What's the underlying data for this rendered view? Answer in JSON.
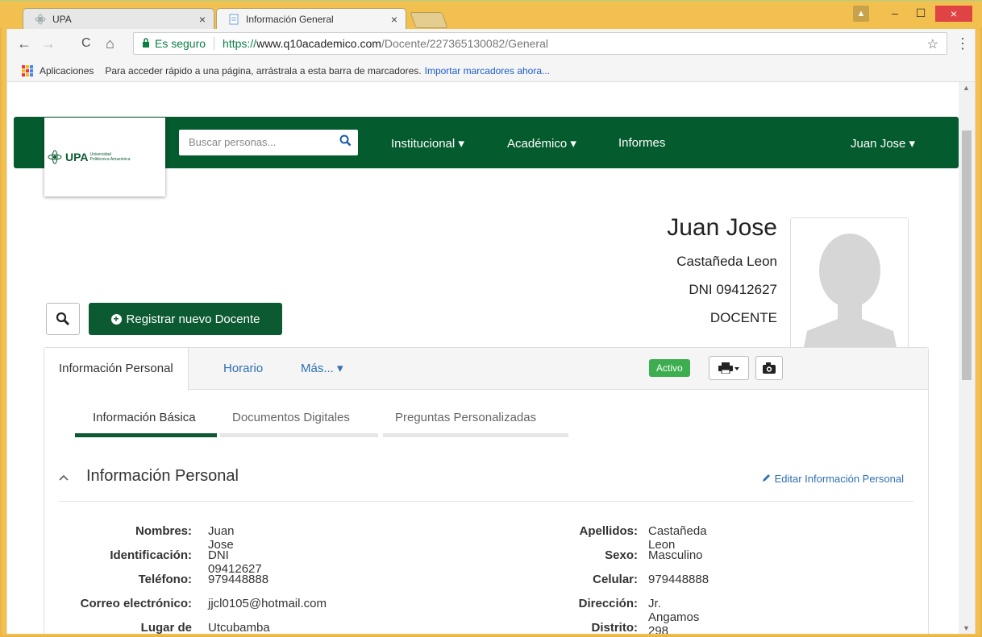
{
  "browser": {
    "tabs": [
      {
        "title": "UPA",
        "close": "×"
      },
      {
        "title": "Información General",
        "close": "×"
      }
    ],
    "window_controls": {
      "user": "▲",
      "minimize": "–",
      "maximize": "☐",
      "close": "×"
    },
    "nav": {
      "back": "←",
      "forward": "→",
      "reload": "C",
      "home": "⌂"
    },
    "omnibox": {
      "secure_label": "Es seguro",
      "url_proto": "https://",
      "url_host": "www.q10academico.com",
      "url_path": "/Docente/227365130082/General"
    },
    "star": "☆",
    "menu": "⋮",
    "bookmarks": {
      "apps": "Aplicaciones",
      "hint": "Para acceder rápido a una página, arrástrala a esta barra de marcadores.",
      "import_link": "Importar marcadores ahora..."
    }
  },
  "site": {
    "logo": {
      "text": "UPA",
      "sub1": "Universidad",
      "sub2": "Politécnica Amazónica"
    },
    "search_placeholder": "Buscar personas...",
    "nav": {
      "institucional": "Institucional ▾",
      "academico": "Académico ▾",
      "informes": "Informes",
      "user": "Juan Jose ▾"
    }
  },
  "profile": {
    "first_name": "Juan Jose",
    "last_name": "Castañeda Leon",
    "dni": "DNI 09412627",
    "role": "DOCENTE"
  },
  "actions": {
    "register_label": "Registrar nuevo Docente"
  },
  "panel": {
    "tabs": {
      "personal": "Información Personal",
      "horario": "Horario",
      "mas": "Más... ▾"
    },
    "status_badge": "Activo",
    "subtabs": {
      "basica": "Información Básica",
      "documentos": "Documentos Digitales",
      "preguntas": "Preguntas Personalizadas"
    },
    "section_title": "Información Personal",
    "edit_link": "Editar Información Personal"
  },
  "fields_left": [
    {
      "label": "Nombres:",
      "value": "Juan Jose"
    },
    {
      "label": "Identificación:",
      "value": "DNI 09412627"
    },
    {
      "label": "Teléfono:",
      "value": "979448888"
    },
    {
      "label": "Correo electrónico:",
      "value": "jjcl0105@hotmail.com"
    },
    {
      "label": "Lugar de",
      "value": "Utcubamba"
    }
  ],
  "fields_right": [
    {
      "label": "Apellidos:",
      "value": "Castañeda Leon"
    },
    {
      "label": "Sexo:",
      "value": "Masculino"
    },
    {
      "label": "Celular:",
      "value": "979448888"
    },
    {
      "label": "Dirección:",
      "value": "Jr. Angamos 298"
    },
    {
      "label": "Distrito:",
      "value": ""
    }
  ],
  "colors": {
    "brand_green": "#045b2e",
    "link_blue": "#2f6fb3",
    "active_badge": "#3cae50"
  }
}
